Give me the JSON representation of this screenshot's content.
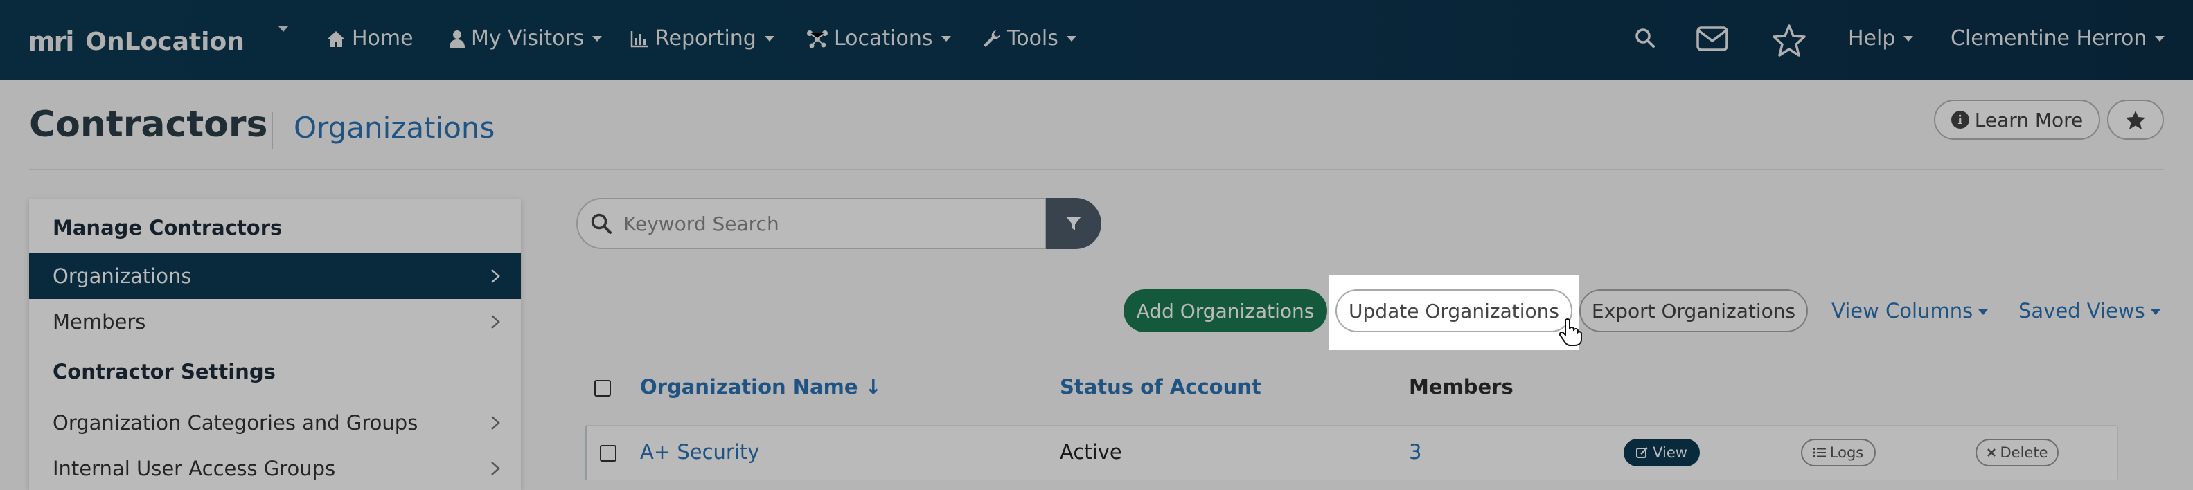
{
  "navbar": {
    "brand": "OnLocation",
    "logo_text": "mri",
    "items": [
      {
        "label": "Home",
        "icon": "home-icon"
      },
      {
        "label": "My Visitors",
        "icon": "user-icon"
      },
      {
        "label": "Reporting",
        "icon": "bar-chart-icon"
      },
      {
        "label": "Locations",
        "icon": "network-icon"
      },
      {
        "label": "Tools",
        "icon": "wrench-icon"
      }
    ],
    "help_label": "Help",
    "user_label": "Clementine Herron"
  },
  "header": {
    "title": "Contractors",
    "subtitle": "Organizations",
    "learn_more_label": "Learn More"
  },
  "sidebar": {
    "section1": "Manage Contractors",
    "items1": [
      {
        "label": "Organizations",
        "active": true
      },
      {
        "label": "Members",
        "active": false
      }
    ],
    "section2": "Contractor Settings",
    "items2": [
      {
        "label": "Organization Categories and Groups"
      },
      {
        "label": "Internal User Access Groups"
      }
    ]
  },
  "search": {
    "placeholder": "Keyword Search"
  },
  "toolbar": {
    "add_label": "Add Organizations",
    "update_label": "Update Organizations",
    "export_label": "Export Organizations",
    "view_columns_label": "View Columns",
    "saved_views_label": "Saved Views"
  },
  "table": {
    "columns": [
      "Organization Name ↓",
      "Status of Account",
      "Members"
    ],
    "rows": [
      {
        "name": "A+ Security",
        "status": "Active",
        "members": "3",
        "view": "View",
        "logs": "Logs",
        "delete": "Delete"
      }
    ]
  },
  "colors": {
    "navbar": "#0c3a53",
    "accent_link": "#2a72b5",
    "add_button": "#1e7a53"
  }
}
